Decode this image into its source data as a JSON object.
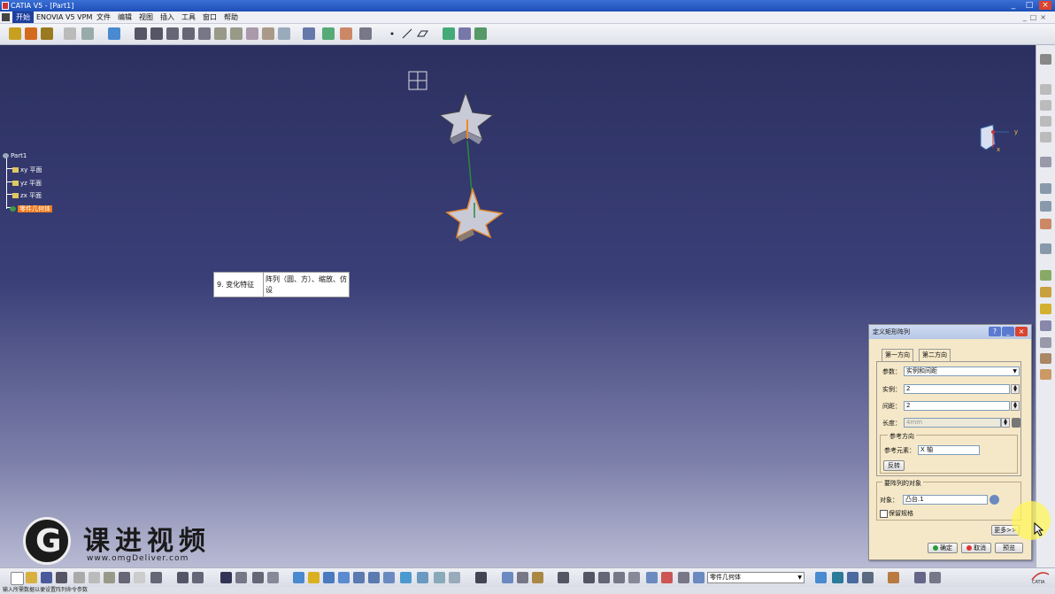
{
  "window": {
    "title": "CATIA V5 - [Part1]",
    "controls": [
      "_",
      "□",
      "×"
    ]
  },
  "menu": {
    "items": [
      "开始",
      "ENOVIA V5 VPM",
      "文件",
      "编辑",
      "视图",
      "插入",
      "工具",
      "窗口",
      "帮助"
    ]
  },
  "tree": {
    "root": "Part1",
    "items": [
      "xy 平面",
      "yz 平面",
      "zx 平面",
      "零件几何体"
    ],
    "selected": "零件几何体"
  },
  "note": {
    "left": "9. 变化特征",
    "right": "阵列（圆、方）、缩放、仿设"
  },
  "compass": {
    "axis_y": "y",
    "axis_x": "x"
  },
  "dialog": {
    "title": "定义矩形阵列",
    "tabs": [
      "第一方向",
      "第二方向"
    ],
    "params_label": "参数：",
    "params_value": "实例和间距",
    "instances_label": "实例：",
    "instances_value": "2",
    "spacing_label": "间距：",
    "spacing_value": "2",
    "length_label": "长度：",
    "length_value": "4mm",
    "ref_dir_group": "参考方向",
    "ref_element_label": "参考元素：",
    "ref_element_value": "X 轴",
    "reverse_button": "反转",
    "object_group": "要阵列的对象",
    "object_label": "对象：",
    "object_value": "凸台.1",
    "keep_spec_label": "保留规格",
    "keep_spec_checked": false,
    "more_button": "更多>>",
    "ok_button": "确定",
    "cancel_button": "取消",
    "preview_button": "预览"
  },
  "bottom_toolbar": {
    "body_combo": "零件几何体"
  },
  "status": {
    "text": "输入所需数据以便设置阵列命令参数"
  },
  "watermark": {
    "brand": "课进视频",
    "url": "www.omgDeliver.com"
  },
  "brand_corner": "CATIA",
  "colors": {
    "viewport_top": "#2c3060",
    "viewport_bottom": "#b9bbd4",
    "dialog_bg": "#f5e8c8",
    "selected": "#f07a1a",
    "titlebar": "#1e4fb8"
  }
}
